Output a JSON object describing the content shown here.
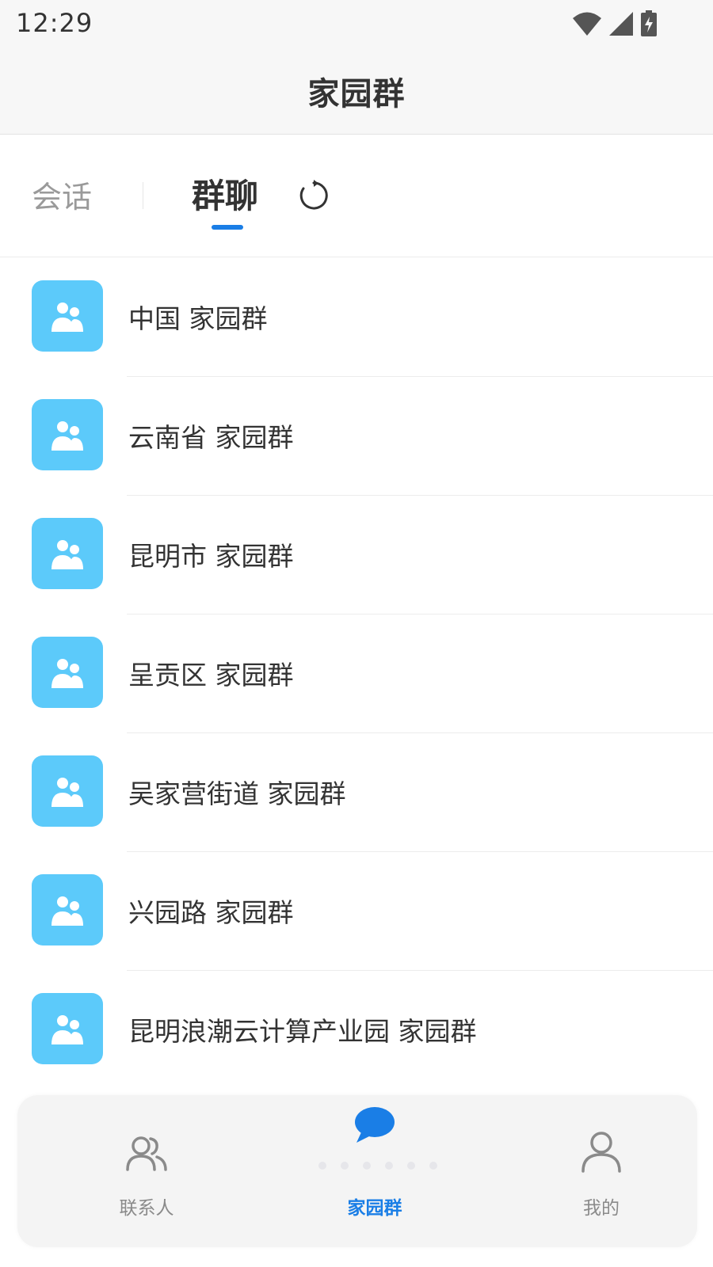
{
  "status_bar": {
    "time": "12:29",
    "icons": [
      "wifi-icon",
      "cell-signal-icon",
      "battery-charging-icon"
    ]
  },
  "header": {
    "title": "家园群"
  },
  "tabs": {
    "session_label": "会话",
    "group_label": "群聊",
    "active": "群聊",
    "accent_color": "#1a7ee6"
  },
  "groups": [
    {
      "name": "中国 家园群"
    },
    {
      "name": "云南省 家园群"
    },
    {
      "name": "昆明市 家园群"
    },
    {
      "name": "呈贡区 家园群"
    },
    {
      "name": "吴家营街道 家园群"
    },
    {
      "name": "兴园路 家园群"
    },
    {
      "name": "昆明浪潮云计算产业园 家园群"
    }
  ],
  "avatar_color": "#5ccafa",
  "bottom_nav": {
    "items": [
      {
        "label": "联系人",
        "icon": "contacts-icon"
      },
      {
        "label": "家园群",
        "icon": "chat-bubble-icon",
        "active": true
      },
      {
        "label": "我的",
        "icon": "person-icon"
      }
    ]
  }
}
